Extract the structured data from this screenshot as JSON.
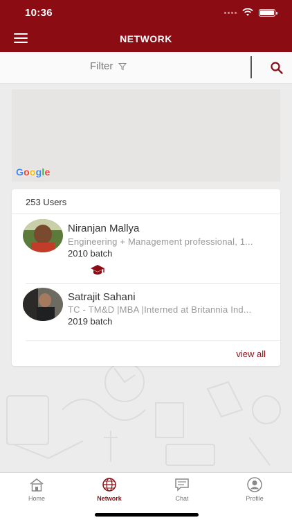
{
  "status_bar": {
    "time": "10:36"
  },
  "header": {
    "title": "NETWORK",
    "menu_icon": "hamburger-icon"
  },
  "filter_bar": {
    "label": "Filter",
    "filter_icon": "funnel-icon",
    "search_icon": "search-icon"
  },
  "map": {
    "attribution": "Google"
  },
  "users": {
    "count_label": "253 Users",
    "items": [
      {
        "name": "Niranjan Mallya",
        "description": "Engineering + Management professional, 1...",
        "batch": "2010 batch",
        "badge_icon": "graduation-cap-icon"
      },
      {
        "name": "Satrajit Sahani",
        "description": "TC - TM&D |MBA |Interned at Britannia Ind...",
        "batch": "2019 batch"
      }
    ],
    "view_all_label": "view all"
  },
  "bottom_nav": {
    "items": [
      {
        "label": "Home",
        "icon": "home-icon"
      },
      {
        "label": "Network",
        "icon": "globe-icon",
        "active": true
      },
      {
        "label": "Chat",
        "icon": "chat-icon"
      },
      {
        "label": "Profile",
        "icon": "profile-icon"
      }
    ]
  },
  "colors": {
    "brand": "#8b0c13",
    "background": "#ececec",
    "text_muted": "#999999"
  }
}
